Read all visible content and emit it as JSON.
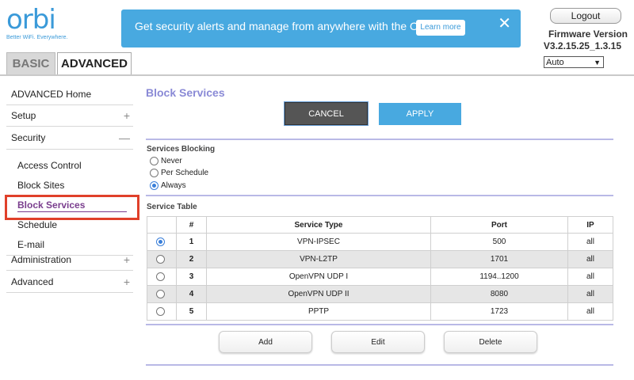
{
  "brand": {
    "name": "orbi",
    "tagline": "Better WiFi. Everywhere.",
    "color": "#3a9ad9"
  },
  "banner": {
    "text": "Get security alerts and manage from anywhere with the Orbi App.",
    "learn_more": "Learn more",
    "close_icon": "✕"
  },
  "header": {
    "logout": "Logout",
    "firmware_label": "Firmware Version",
    "firmware_value": "V3.2.15.25_1.3.15",
    "language": "Auto"
  },
  "tabs": [
    {
      "label": "BASIC"
    },
    {
      "label": "ADVANCED"
    }
  ],
  "sidebar": {
    "items": [
      {
        "label": "ADVANCED Home"
      },
      {
        "label": "Setup",
        "icon": "+"
      },
      {
        "label": "Security",
        "icon": "—"
      },
      {
        "label": "Access Control"
      },
      {
        "label": "Block Sites"
      },
      {
        "label": "Block Services"
      },
      {
        "label": "Schedule"
      },
      {
        "label": "E-mail"
      },
      {
        "label": "Administration",
        "icon": "+"
      },
      {
        "label": "Advanced",
        "icon": "+"
      }
    ]
  },
  "main": {
    "title": "Block Services",
    "cancel": "CANCEL",
    "apply": "APPLY",
    "blocking": {
      "label": "Services Blocking",
      "options": [
        {
          "label": "Never"
        },
        {
          "label": "Per Schedule"
        },
        {
          "label": "Always"
        }
      ],
      "selected": "Always"
    },
    "table": {
      "label": "Service Table",
      "headers": [
        "",
        "#",
        "Service Type",
        "Port",
        "IP"
      ],
      "rows": [
        {
          "num": "1",
          "type": "VPN-IPSEC",
          "port": "500",
          "ip": "all",
          "selected": true
        },
        {
          "num": "2",
          "type": "VPN-L2TP",
          "port": "1701",
          "ip": "all"
        },
        {
          "num": "3",
          "type": "OpenVPN UDP I",
          "port": "1194..1200",
          "ip": "all"
        },
        {
          "num": "4",
          "type": "OpenVPN UDP II",
          "port": "8080",
          "ip": "all"
        },
        {
          "num": "5",
          "type": "PPTP",
          "port": "1723",
          "ip": "all"
        }
      ]
    },
    "actions": {
      "add": "Add",
      "edit": "Edit",
      "delete": "Delete"
    }
  }
}
